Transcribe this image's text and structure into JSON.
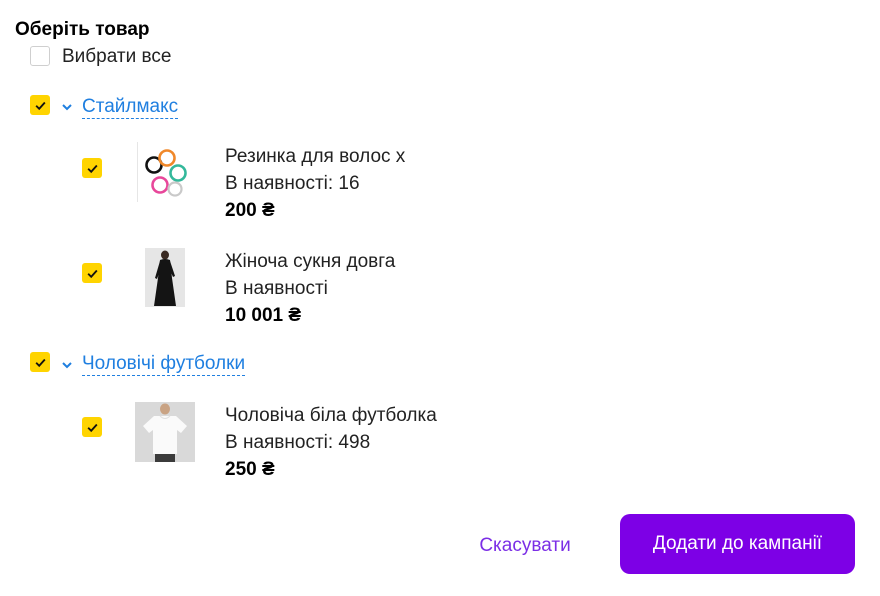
{
  "header": {
    "title": "Оберіть товар"
  },
  "select_all": {
    "label": "Вибрати все",
    "checked": false
  },
  "groups": [
    {
      "name": "Стайлмакс",
      "checked": true,
      "items": [
        {
          "name": "Резинка для волос х",
          "stock": "В наявності: 16",
          "price": "200 ₴",
          "checked": true,
          "thumb": "hair-ties"
        },
        {
          "name": "Жіноча сукня довга",
          "stock": "В наявності",
          "price": "10 001 ₴",
          "checked": true,
          "thumb": "black-dress"
        }
      ]
    },
    {
      "name": "Чоловічі футболки",
      "checked": true,
      "items": [
        {
          "name": "Чоловіча біла футболка",
          "stock": "В наявності: 498",
          "price": "250 ₴",
          "checked": true,
          "thumb": "white-tshirt"
        }
      ]
    }
  ],
  "actions": {
    "cancel_label": "Скасувати",
    "submit_label": "Додати до кампанії"
  },
  "colors": {
    "checkbox": "#ffd400",
    "link": "#1f7fe0",
    "primary": "#7d00e6",
    "cancel_text": "#7b2ee6"
  }
}
